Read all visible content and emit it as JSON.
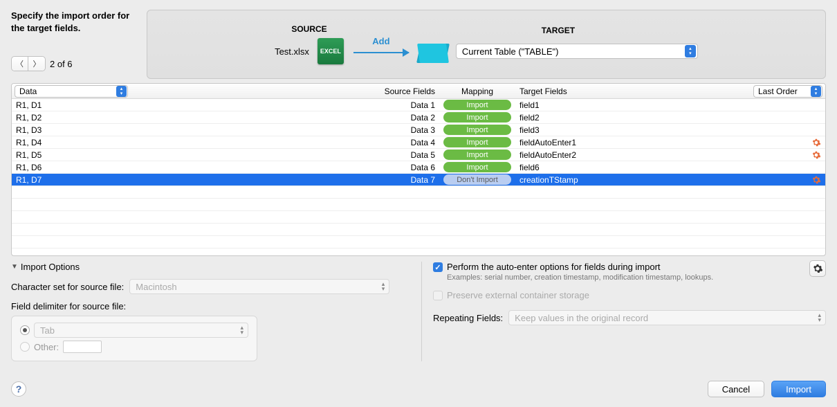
{
  "header": {
    "instruction": "Specify the import order for the target fields.",
    "pager_text": "2 of 6",
    "source_label": "SOURCE",
    "target_label": "TARGET",
    "source_file": "Test.xlsx",
    "arrow_label": "Add",
    "target_select": "Current Table (\"TABLE\")"
  },
  "table": {
    "src_mode": "Data",
    "src_header": "Source Fields",
    "map_header": "Mapping",
    "tgt_header": "Target Fields",
    "sort_mode": "Last Order",
    "rows": [
      {
        "src": "R1, D1",
        "dn": "Data 1",
        "map": "Import",
        "mtype": "green",
        "tgt": "field1",
        "gear": false,
        "sel": false
      },
      {
        "src": "R1, D2",
        "dn": "Data 2",
        "map": "Import",
        "mtype": "green",
        "tgt": "field2",
        "gear": false,
        "sel": false
      },
      {
        "src": "R1, D3",
        "dn": "Data 3",
        "map": "Import",
        "mtype": "green",
        "tgt": "field3",
        "gear": false,
        "sel": false
      },
      {
        "src": "R1, D4",
        "dn": "Data 4",
        "map": "Import",
        "mtype": "green",
        "tgt": "fieldAutoEnter1",
        "gear": true,
        "sel": false
      },
      {
        "src": "R1, D5",
        "dn": "Data 5",
        "map": "Import",
        "mtype": "green",
        "tgt": "fieldAutoEnter2",
        "gear": true,
        "sel": false
      },
      {
        "src": "R1, D6",
        "dn": "Data 6",
        "map": "Import",
        "mtype": "green",
        "tgt": "field6",
        "gear": false,
        "sel": false
      },
      {
        "src": "R1, D7",
        "dn": "Data 7",
        "map": "Don't Import",
        "mtype": "gray",
        "tgt": "creationTStamp",
        "gear": true,
        "sel": true
      }
    ]
  },
  "options": {
    "header": "Import Options",
    "charset_label": "Character set for source file:",
    "charset_value": "Macintosh",
    "delim_label": "Field delimiter for source file:",
    "delim_tab": "Tab",
    "delim_other": "Other:",
    "autoenter_label": "Perform the auto-enter options for fields during import",
    "autoenter_sub": "Examples: serial number, creation timestamp, modification timestamp, lookups.",
    "preserve_label": "Preserve external container storage",
    "repeat_label": "Repeating Fields:",
    "repeat_value": "Keep values in the original record"
  },
  "footer": {
    "cancel": "Cancel",
    "import": "Import"
  }
}
